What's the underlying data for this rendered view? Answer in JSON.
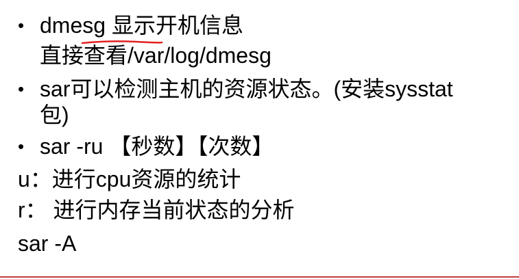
{
  "slide": {
    "items": [
      {
        "bullet": "•",
        "text": "dmesg 显示开机信息"
      },
      {
        "bullet": "",
        "text": "直接查看/var/log/dmesg"
      },
      {
        "bullet": "•",
        "text": "sar可以检测主机的资源状态。(安装sysstat"
      },
      {
        "bullet": "",
        "text": "包)"
      },
      {
        "bullet": "•",
        "text": "sar -ru 【秒数】【次数】"
      },
      {
        "bullet": "",
        "text": "u：进行cpu资源的统计"
      },
      {
        "bullet": "",
        "text": "r： 进行内存当前状态的分析"
      },
      {
        "bullet": "",
        "text": "sar -A"
      }
    ]
  },
  "colors": {
    "text": "#000000",
    "annotation": "#e02020",
    "rule": "#c43c3c",
    "background": "#ffffff"
  }
}
